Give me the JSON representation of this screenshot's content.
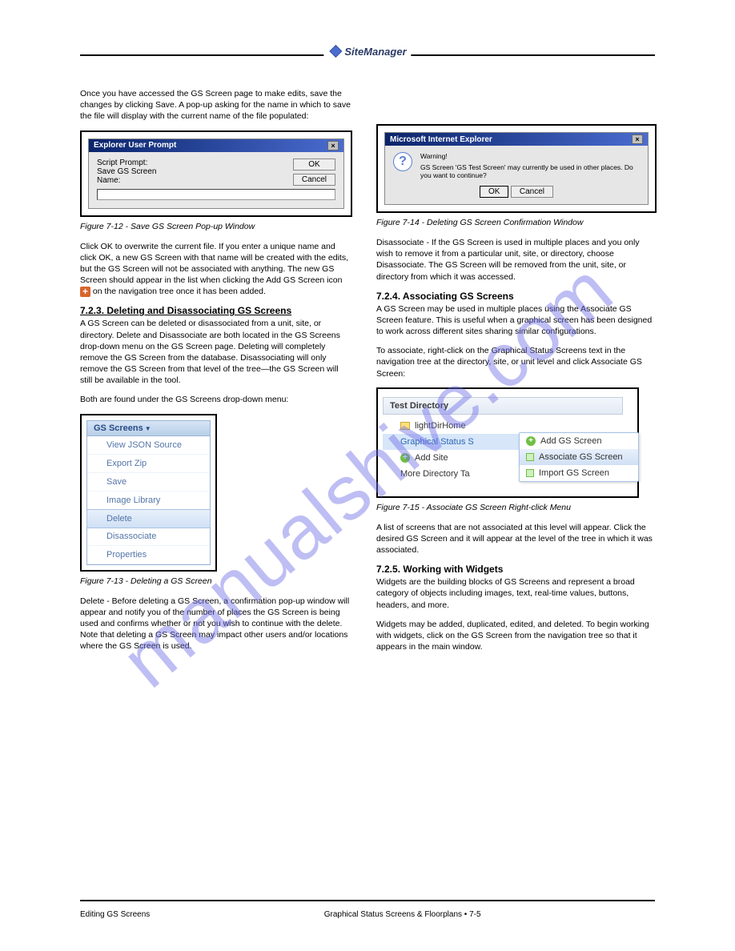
{
  "brand": "SiteManager",
  "watermark": "manualshive.com",
  "left": {
    "para1": "Once you have accessed the GS Screen page to make edits, save the changes by clicking Save. A pop-up asking for the name in which to save the file will display with the current name of the file populated:",
    "dlg1": {
      "title": "Explorer User Prompt",
      "script_prompt": "Script Prompt:",
      "save_label1": "Save GS Screen",
      "save_label2": "Name:",
      "ok": "OK",
      "cancel": "Cancel"
    },
    "fig1": "Figure 7-12 - Save GS Screen Pop-up Window",
    "para2_a": "Click OK to overwrite the current file. If you enter a unique name and click OK, a new GS Screen with that name will be created with the edits, but the GS Screen will not be associated with anything. The new GS Screen should appear in the list when clicking the Add GS Screen icon",
    "para2_b": " on the navigation tree once it has been added.",
    "sec_num": "7.2.3.",
    "sec_title": "Deleting and Disassociating GS Screens",
    "para3": "A GS Screen can be deleted or disassociated from a unit, site, or directory. Delete and Disassociate are both located in the GS Screens drop-down menu on the GS Screen page. Deleting will completely remove the GS Screen from the database. Disassociating will only remove the GS Screen from that level of the tree—the GS Screen will still be available in the tool.",
    "para4": "Both are found under the GS Screens drop-down menu:",
    "menu": {
      "header": "GS Screens",
      "items": [
        "View JSON Source",
        "Export Zip",
        "Save",
        "Image Library",
        "Delete",
        "Disassociate",
        "Properties"
      ]
    },
    "fig2": "Figure 7-13 - Deleting a GS Screen",
    "para5": "Delete - Before deleting a GS Screen, a confirmation pop-up window will appear and notify you of the number of places the GS Screen is being used and confirms whether or not you wish to continue with the delete. Note that deleting a GS Screen may impact other users and/or locations where the GS Screen is used."
  },
  "right": {
    "dlg2": {
      "title": "Microsoft Internet Explorer",
      "warn": "Warning!",
      "msg": "GS Screen 'GS Test Screen' may currently be used in other places.  Do you want to continue?",
      "ok": "OK",
      "cancel": "Cancel"
    },
    "fig3": "Figure 7-14 - Deleting GS Screen Confirmation Window",
    "para1": "Disassociate - If the GS Screen is used in multiple places and you only wish to remove it from a particular unit, site, or directory, choose Disassociate. The GS Screen will be removed from the unit, site, or directory from which it was accessed.",
    "sec_num": "7.2.4.",
    "sec_title": "Associating GS Screens",
    "para2": "A GS Screen may be used in multiple places using the Associate GS Screen feature. This is useful when a graphical screen has been designed to work across different sites sharing similar configurations.",
    "para3": "To associate, right-click on the Graphical Status Screens text in the navigation tree at the directory, site, or unit level and click Associate GS Screen:",
    "tree": {
      "header": "Test Directory",
      "items": [
        "lightDirHome",
        "Graphical Status S",
        "Add Site",
        "More Directory Ta"
      ],
      "sub": [
        "Add GS Screen",
        "Associate GS Screen",
        "Import GS Screen"
      ]
    },
    "fig4": "Figure 7-15 - Associate GS Screen Right-click Menu",
    "para4": "A list of screens that are not associated at this level will appear. Click the desired GS Screen and it will appear at the level of the tree in which it was associated.",
    "sec2_num": "7.2.5.",
    "sec2_title": "Working with Widgets",
    "para5": "Widgets are the building blocks of GS Screens and represent a broad category of objects including images, text, real-time values, buttons, headers, and more.",
    "para6": "Widgets may be added, duplicated, edited, and deleted. To begin working with widgets, click on the GS Screen from the navigation tree so that it appears in the main window."
  },
  "footer": {
    "left": "Editing GS Screens",
    "mid": "Graphical Status Screens & Floorplans • 7-5",
    "right": ""
  }
}
